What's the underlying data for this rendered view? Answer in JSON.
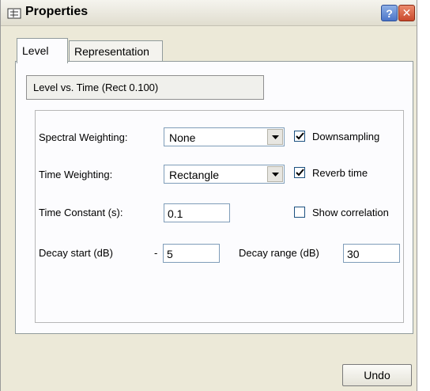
{
  "window": {
    "title": "Properties",
    "help_label": "?",
    "close_label": "✕"
  },
  "tabs": [
    {
      "label": "Level",
      "active": true
    },
    {
      "label": "Representation",
      "active": false
    }
  ],
  "summary": "Level vs. Time (Rect 0.100)",
  "settings": {
    "spectral_weighting_label": "Spectral Weighting:",
    "spectral_weighting_value": "None",
    "time_weighting_label": "Time Weighting:",
    "time_weighting_value": "Rectangle",
    "time_constant_label": "Time Constant (s):",
    "time_constant_value": "0.1",
    "decay_start_label": "Decay start (dB)",
    "decay_start_sign": "-",
    "decay_start_value": "5",
    "decay_range_label": "Decay range (dB)",
    "decay_range_value": "30"
  },
  "options": {
    "downsampling_label": "Downsampling",
    "downsampling_checked": true,
    "reverb_time_label": "Reverb time",
    "reverb_time_checked": true,
    "show_correlation_label": "Show correlation",
    "show_correlation_checked": false
  },
  "footer": {
    "undo_label": "Undo"
  }
}
